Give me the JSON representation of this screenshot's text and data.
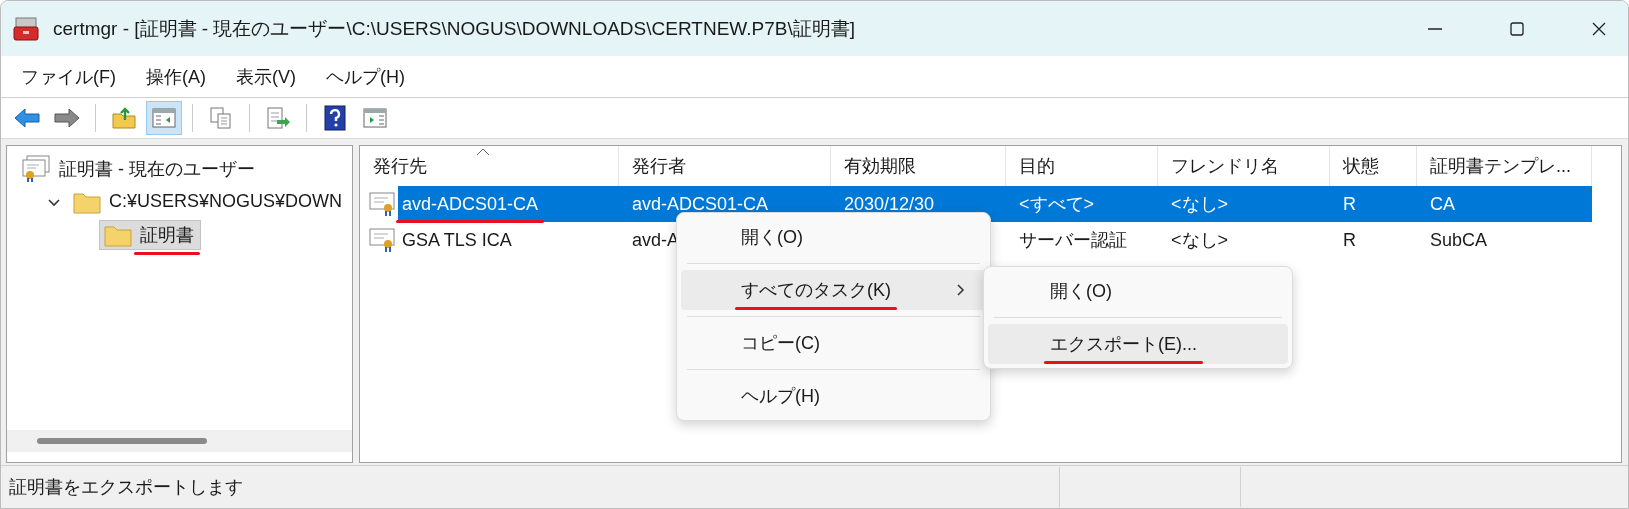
{
  "window": {
    "title": "certmgr - [証明書 - 現在のユーザー\\C:\\USERS\\NOGUS\\DOWNLOADS\\CERTNEW.P7B\\証明書]"
  },
  "menu_bar": [
    "ファイル(F)",
    "操作(A)",
    "表示(V)",
    "ヘルプ(H)"
  ],
  "toolbar": [
    {
      "kind": "back",
      "pressed": false
    },
    {
      "kind": "forward",
      "pressed": false
    },
    {
      "kind": "up",
      "pressed": false
    },
    {
      "kind": "tree",
      "pressed": true
    },
    {
      "kind": "copy",
      "pressed": false
    },
    {
      "kind": "export",
      "pressed": false
    },
    {
      "kind": "help",
      "pressed": false
    },
    {
      "kind": "action",
      "pressed": false
    }
  ],
  "tree": [
    {
      "label": "証明書 - 現在のユーザー",
      "selected": false,
      "underlined": false,
      "children": [
        {
          "label": "C:¥USERS¥NOGUS¥DOWN",
          "expanded": true,
          "selected": false,
          "underlined": false,
          "children": [
            {
              "label": "証明書",
              "selected": true,
              "underlined": true
            }
          ]
        }
      ]
    }
  ],
  "table": {
    "columns": [
      {
        "label": "発行先",
        "sorted": true
      },
      {
        "label": "発行者",
        "sorted": false
      },
      {
        "label": "有効期限",
        "sorted": false
      },
      {
        "label": "目的",
        "sorted": false
      },
      {
        "label": "フレンドリ名",
        "sorted": false
      },
      {
        "label": "状態",
        "sorted": false
      },
      {
        "label": "証明書テンプレ...",
        "sorted": false
      }
    ],
    "rows": [
      {
        "selected": true,
        "underlined": true,
        "cells": [
          "avd-ADCS01-CA",
          "avd-ADCS01-CA",
          "2030/12/30",
          "<すべて>",
          "<なし>",
          "R",
          "CA"
        ]
      },
      {
        "selected": false,
        "underlined": false,
        "cells": [
          "GSA TLS ICA",
          "avd-A",
          "",
          "サーバー認証",
          "<なし>",
          "R",
          "SubCA"
        ]
      }
    ]
  },
  "context_menu": {
    "items": [
      {
        "label": "開く(O)",
        "selected": false,
        "submenu": false,
        "underlined": false
      },
      {
        "label": "すべてのタスク(K)",
        "selected": true,
        "submenu": true,
        "underlined": true
      },
      {
        "label": "コピー(C)",
        "selected": false,
        "submenu": false,
        "underlined": false
      },
      {
        "label": "ヘルプ(H)",
        "selected": false,
        "submenu": false,
        "underlined": false
      }
    ]
  },
  "submenu": {
    "items": [
      {
        "label": "開く(O)",
        "selected": false,
        "underlined": false
      },
      {
        "label": "エクスポート(E)...",
        "selected": true,
        "underlined": true
      }
    ]
  },
  "status_bar": {
    "text": "証明書をエクスポートします"
  }
}
